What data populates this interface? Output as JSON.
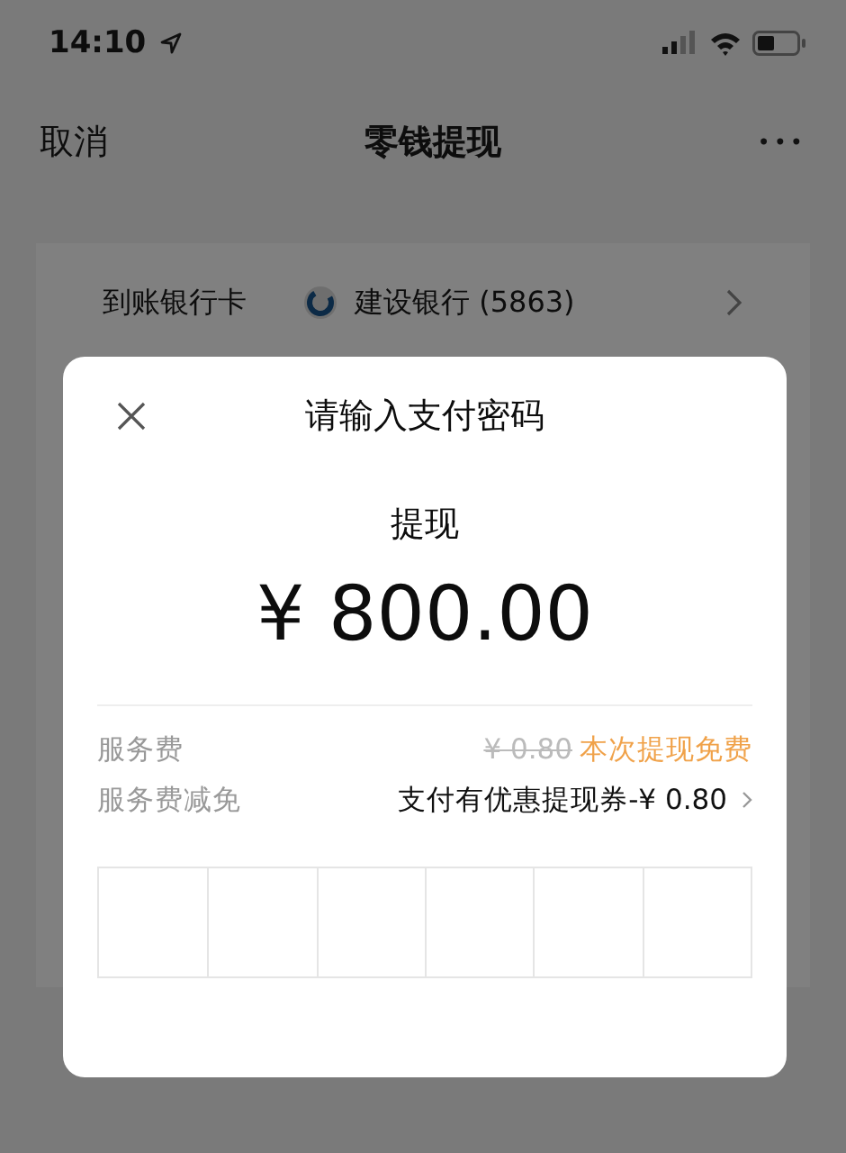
{
  "status_bar": {
    "time": "14:10"
  },
  "nav": {
    "cancel": "取消",
    "title": "零钱提现",
    "more": "•••"
  },
  "card": {
    "label": "到账银行卡",
    "bank": "建设银行 (5863)"
  },
  "dialog": {
    "title": "请输入支付密码",
    "subtitle": "提现",
    "amount": "¥ 800.00",
    "fees": [
      {
        "label": "服务费",
        "original": "¥ 0.80",
        "value": "本次提现免费",
        "kind": "free"
      },
      {
        "label": "服务费减免",
        "value": "支付有优惠提现券-¥ 0.80",
        "kind": "link"
      }
    ]
  }
}
